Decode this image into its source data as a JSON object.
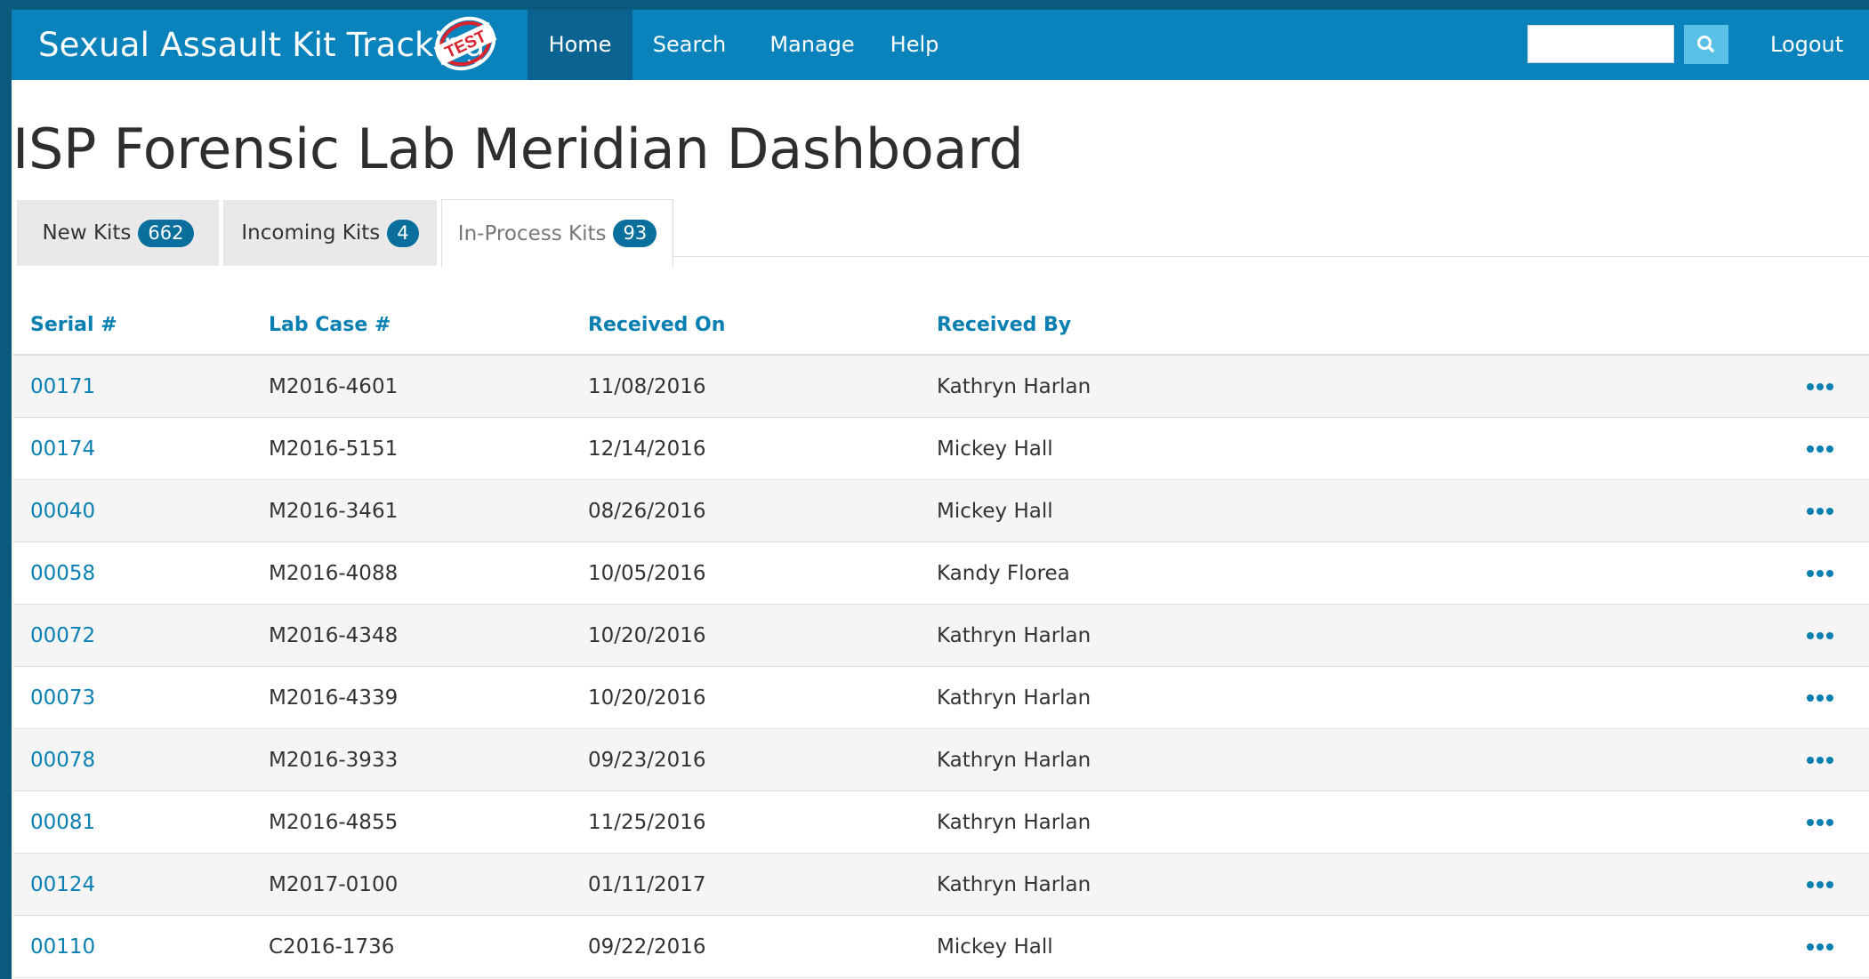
{
  "navbar": {
    "brand": "Sexual Assault Kit Tracking",
    "stamp_text": "TEST",
    "items": [
      {
        "label": "Home",
        "active": true
      },
      {
        "label": "Search",
        "active": false
      },
      {
        "label": "Manage",
        "active": false
      },
      {
        "label": "Help",
        "active": false
      }
    ],
    "search": {
      "value": "",
      "placeholder": ""
    },
    "search_icon": "search-icon",
    "logout_label": "Logout"
  },
  "page": {
    "title": "ISP Forensic Lab Meridian Dashboard"
  },
  "tabs": [
    {
      "label": "New Kits",
      "count": "662",
      "active": false
    },
    {
      "label": "Incoming Kits",
      "count": "4",
      "active": false
    },
    {
      "label": "In-Process Kits",
      "count": "93",
      "active": true
    }
  ],
  "table": {
    "columns": [
      "Serial #",
      "Lab Case #",
      "Received On",
      "Received By"
    ],
    "rows": [
      {
        "serial": "00171",
        "lab_case": "M2016-4601",
        "received_on": "11/08/2016",
        "received_by": "Kathryn Harlan"
      },
      {
        "serial": "00174",
        "lab_case": "M2016-5151",
        "received_on": "12/14/2016",
        "received_by": "Mickey Hall"
      },
      {
        "serial": "00040",
        "lab_case": "M2016-3461",
        "received_on": "08/26/2016",
        "received_by": "Mickey Hall"
      },
      {
        "serial": "00058",
        "lab_case": "M2016-4088",
        "received_on": "10/05/2016",
        "received_by": "Kandy Florea"
      },
      {
        "serial": "00072",
        "lab_case": "M2016-4348",
        "received_on": "10/20/2016",
        "received_by": "Kathryn Harlan"
      },
      {
        "serial": "00073",
        "lab_case": "M2016-4339",
        "received_on": "10/20/2016",
        "received_by": "Kathryn Harlan"
      },
      {
        "serial": "00078",
        "lab_case": "M2016-3933",
        "received_on": "09/23/2016",
        "received_by": "Kathryn Harlan"
      },
      {
        "serial": "00081",
        "lab_case": "M2016-4855",
        "received_on": "11/25/2016",
        "received_by": "Kathryn Harlan"
      },
      {
        "serial": "00124",
        "lab_case": "M2017-0100",
        "received_on": "01/11/2017",
        "received_by": "Kathryn Harlan"
      },
      {
        "serial": "00110",
        "lab_case": "C2016-1736",
        "received_on": "09/22/2016",
        "received_by": "Mickey Hall"
      }
    ],
    "row_action_icon": "more-dots-icon"
  },
  "colors": {
    "navbar": "#0a83bd",
    "navbar_active": "#0a6391",
    "link": "#0a7fb2",
    "badge": "#0a6f9c",
    "stamp": "#d9232e",
    "frame": "#0a5a7d"
  }
}
